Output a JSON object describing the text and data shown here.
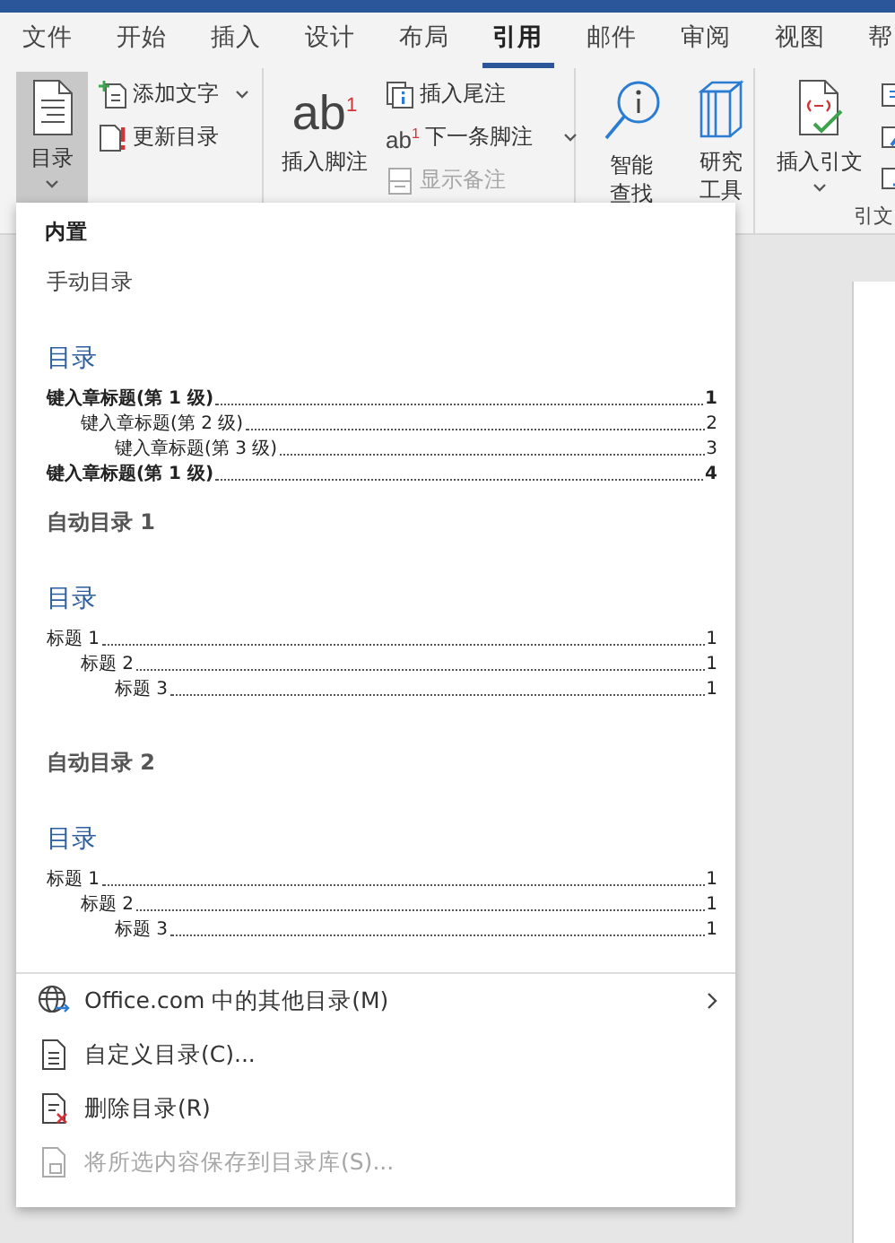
{
  "tabs": [
    {
      "label": "文件",
      "selected": false
    },
    {
      "label": "开始",
      "selected": false
    },
    {
      "label": "插入",
      "selected": false
    },
    {
      "label": "设计",
      "selected": false
    },
    {
      "label": "布局",
      "selected": false
    },
    {
      "label": "引用",
      "selected": true
    },
    {
      "label": "邮件",
      "selected": false
    },
    {
      "label": "审阅",
      "selected": false
    },
    {
      "label": "视图",
      "selected": false
    },
    {
      "label": "帮",
      "selected": false
    }
  ],
  "ribbon": {
    "groups": [
      {
        "large": [
          {
            "label": "目录",
            "pressed": true,
            "dropdown": true
          }
        ],
        "small": [
          {
            "label": "添加文字",
            "dropdown": true,
            "disabled": false
          },
          {
            "label": "更新目录",
            "dropdown": false,
            "disabled": false
          }
        ]
      },
      {
        "large": [
          {
            "label": "插入脚注",
            "glyph": "ab$^{1}$",
            "pressed": false,
            "dropdown": false
          }
        ],
        "small": [
          {
            "label": "插入尾注",
            "dropdown": false,
            "disabled": false
          },
          {
            "label": "下一条脚注",
            "glyph": "ab$^{1}$",
            "dropdown": true,
            "disabled": false
          },
          {
            "label": "显示备注",
            "dropdown": false,
            "disabled": true
          }
        ]
      },
      {
        "large": [
          {
            "label": "智能查找",
            "pressed": false,
            "dropdown": false
          },
          {
            "label": "研究工具",
            "pressed": false,
            "dropdown": false
          }
        ]
      },
      {
        "large": [
          {
            "label": "插入引文",
            "pressed": false,
            "dropdown": true
          }
        ],
        "label": "引文"
      }
    ]
  },
  "toc_menu": {
    "header": "内置",
    "gallery": [
      {
        "kind": "manual",
        "title": "手动目录",
        "heading": "目录",
        "entries": [
          {
            "text": "键入章标题(第 1 级)",
            "page": "1",
            "children": [
              {
                "text": "键入章标题(第 2 级)",
                "page": "2",
                "children": [
                  {
                    "text": "键入章标题(第 3 级)",
                    "page": "3"
                  }
                ]
              }
            ]
          },
          {
            "text": "键入章标题(第 1 级)",
            "page": "4"
          }
        ]
      },
      {
        "kind": "auto",
        "title": "自动目录 1",
        "heading": "目录",
        "entries": [
          {
            "text": "标题 1",
            "page": "1",
            "children": [
              {
                "text": "标题 2",
                "page": "1",
                "children": [
                  {
                    "text": "标题 3",
                    "page": "1"
                  }
                ]
              }
            ]
          }
        ]
      },
      {
        "kind": "auto",
        "title": "自动目录 2",
        "heading": "目录",
        "entries": [
          {
            "text": "标题 1",
            "page": "1",
            "children": [
              {
                "text": "标题 2",
                "page": "1",
                "children": [
                  {
                    "text": "标题 3",
                    "page": "1"
                  }
                ]
              }
            ]
          }
        ]
      }
    ],
    "commands": [
      {
        "label": "Office.com 中的其他目录(M)",
        "submenu": true,
        "disabled": false
      },
      {
        "label": "自定义目录(C)...",
        "submenu": false,
        "disabled": false
      },
      {
        "label": "删除目录(R)",
        "submenu": false,
        "disabled": false
      },
      {
        "label": "将所选内容保存到目录库(S)...",
        "submenu": false,
        "disabled": true
      }
    ]
  }
}
